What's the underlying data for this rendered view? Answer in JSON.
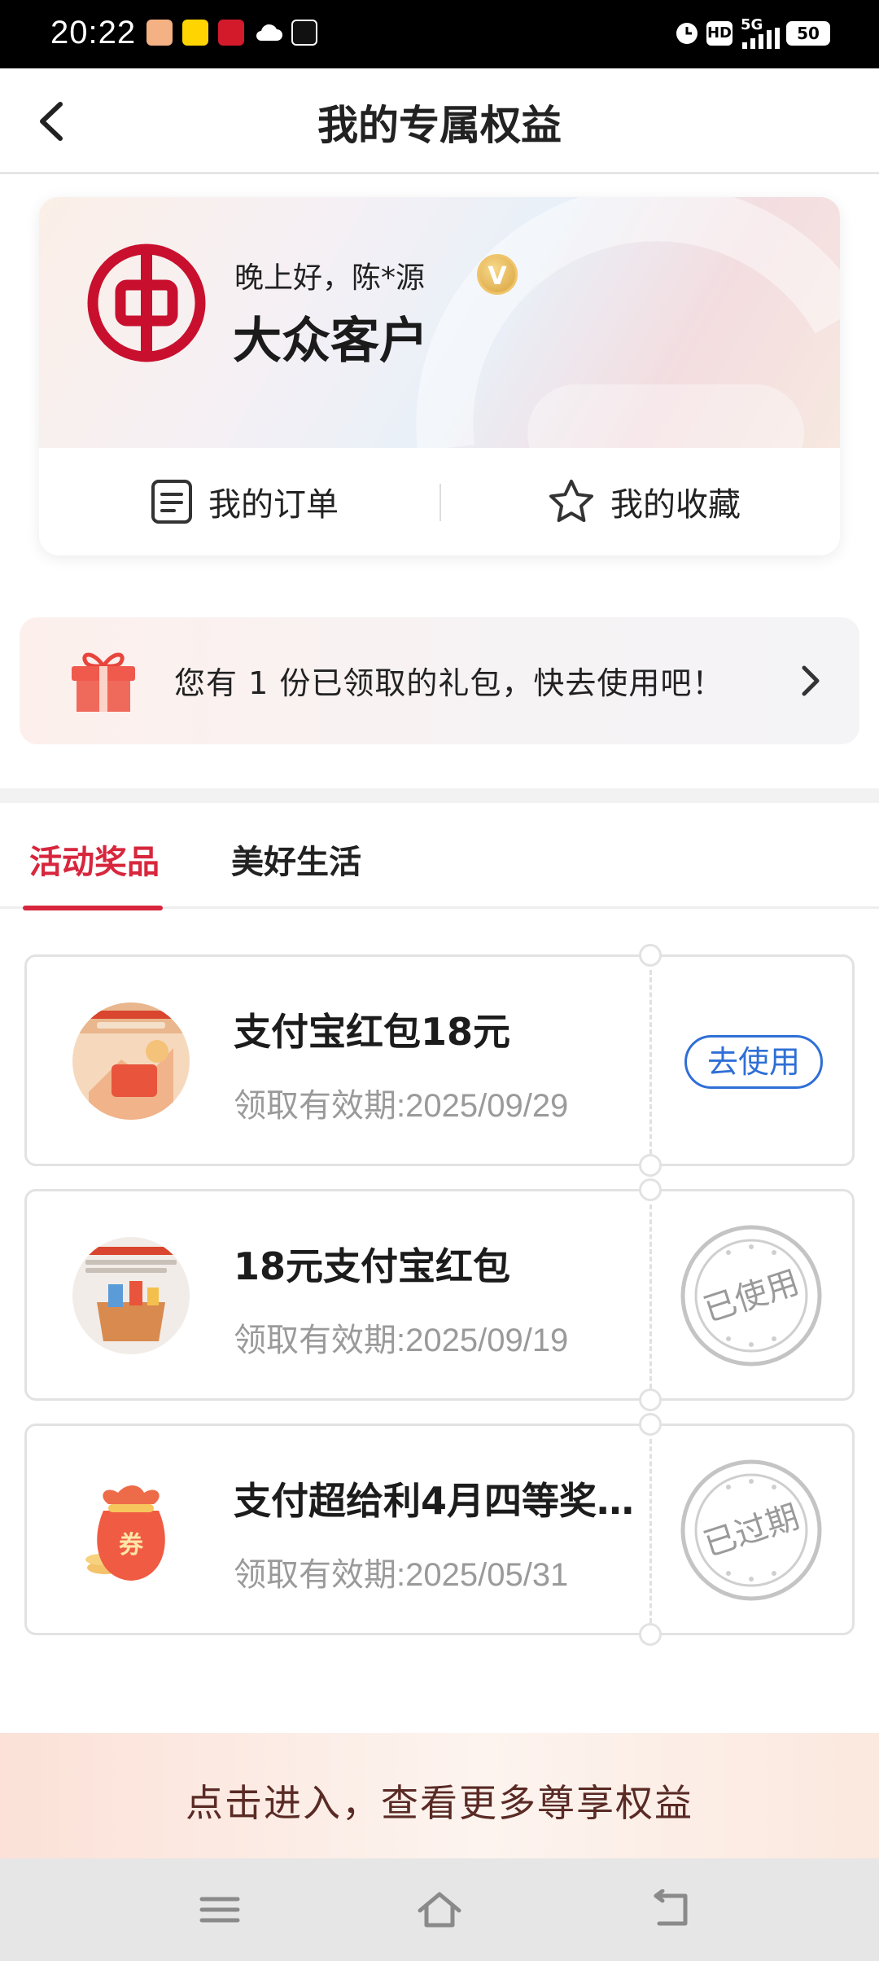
{
  "status_bar": {
    "time": "20:22",
    "network": "5G",
    "hd": "HD",
    "battery": "50",
    "icons": [
      "app-icon-1",
      "app-icon-2",
      "app-icon-3",
      "cloud-icon",
      "tiktok-icon",
      "alarm-icon",
      "hd-icon",
      "signal-icon",
      "battery-icon"
    ]
  },
  "header": {
    "title": "我的专属权益",
    "back_icon": "chevron-left-icon"
  },
  "profile": {
    "greeting": "晚上好，陈*源",
    "vip_badge": "V",
    "level": "大众客户",
    "logo": "bank-of-china-logo",
    "actions": [
      {
        "label": "我的订单",
        "icon": "order-list-icon"
      },
      {
        "label": "我的收藏",
        "icon": "star-outline-icon"
      }
    ]
  },
  "gift_banner": {
    "text": "您有 1 份已领取的礼包，快去使用吧！",
    "icon": "gift-box-icon",
    "chevron": "chevron-right-icon"
  },
  "tabs": [
    {
      "label": "活动奖品",
      "active": true
    },
    {
      "label": "美好生活",
      "active": false
    }
  ],
  "coupons": [
    {
      "name": "支付宝红包18元",
      "validity": "领取有效期:2025/09/29",
      "status": "去使用",
      "state": "available"
    },
    {
      "name": "18元支付宝红包",
      "validity": "领取有效期:2025/09/19",
      "status": "已使用",
      "state": "used"
    },
    {
      "name": "支付超给利4月四等奖…",
      "validity": "领取有效期:2025/05/31",
      "status": "已过期",
      "state": "expired",
      "thumb_badge": "券"
    }
  ],
  "promo": {
    "text": "点击进入，查看更多尊享权益"
  },
  "nav": [
    "menu-icon",
    "home-icon",
    "back-icon"
  ],
  "colors": {
    "accent_red": "#d7263d",
    "link_blue": "#2f6fd6",
    "boc_red": "#c8102e",
    "stamp_gray": "#b8b8b8"
  }
}
